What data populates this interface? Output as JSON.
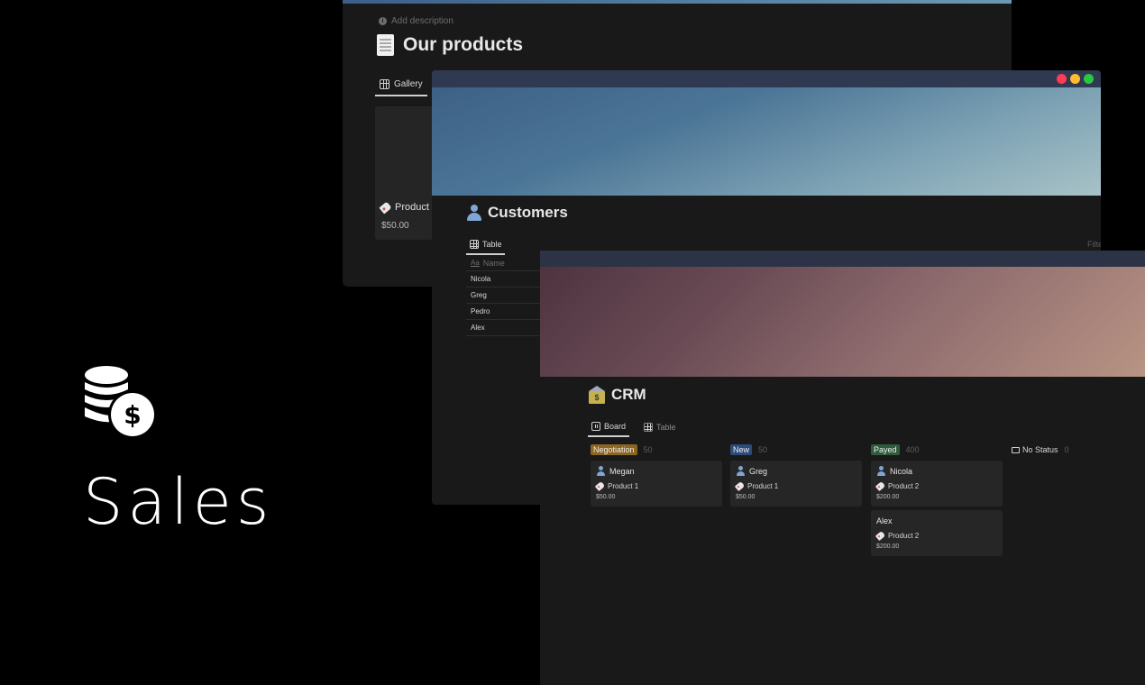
{
  "brand": {
    "title": "Sales",
    "icon": "coins-dollar-icon"
  },
  "products_window": {
    "description": "Add description",
    "title": "Our products",
    "tab": "Gallery",
    "card": {
      "name": "Product",
      "price": "$50.00"
    }
  },
  "customers_window": {
    "title": "Customers",
    "tab": "Table",
    "filter": "Filte",
    "column": "Name",
    "rows": [
      "Nicola",
      "Greg",
      "Pedro",
      "Alex"
    ],
    "traffic_colors": [
      "#ff3b55",
      "#febc2e",
      "#28c840"
    ]
  },
  "crm_window": {
    "title": "CRM",
    "tabs": [
      "Board",
      "Table"
    ],
    "columns": [
      {
        "label": "Negotiation",
        "count": "50",
        "color": "#8c6521",
        "cards": [
          {
            "name": "Megan",
            "product": "Product 1",
            "price": "$50.00"
          }
        ]
      },
      {
        "label": "New",
        "count": "50",
        "color": "#2c4b7a",
        "cards": [
          {
            "name": "Greg",
            "product": "Product 1",
            "price": "$50.00"
          }
        ]
      },
      {
        "label": "Payed",
        "count": "400",
        "color": "#2f5a3c",
        "cards": [
          {
            "name": "Nicola",
            "product": "Product 2",
            "price": "$200.00"
          },
          {
            "name": "Alex",
            "product": "Product 2",
            "price": "$200.00"
          }
        ]
      },
      {
        "label": "No Status",
        "count": "0",
        "color": "",
        "cards": []
      }
    ]
  }
}
